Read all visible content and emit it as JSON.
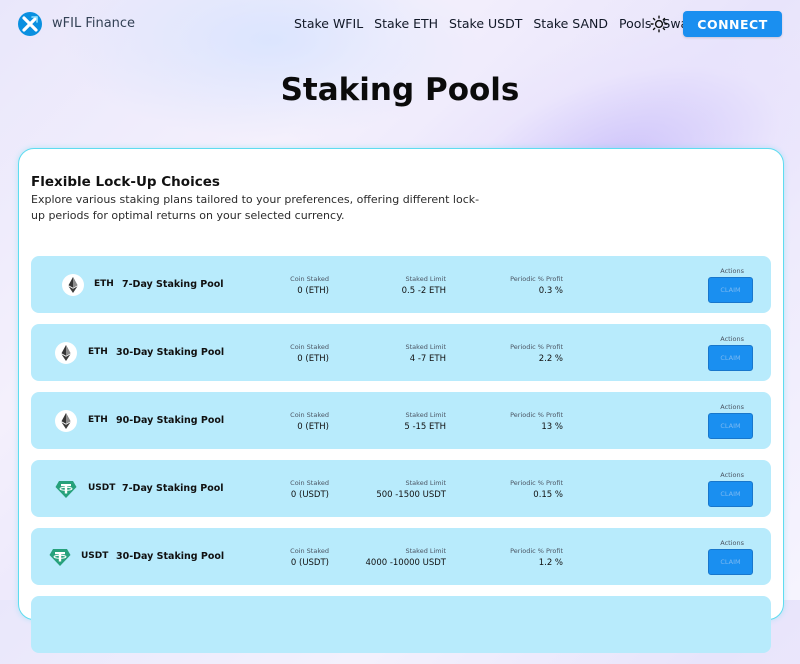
{
  "app": {
    "name": "wFIL Finance"
  },
  "nav": {
    "items": [
      "Stake WFIL",
      "Stake ETH",
      "Stake USDT",
      "Stake SAND",
      "Pools",
      "Swap"
    ],
    "connect_label": "CONNECT"
  },
  "page": {
    "title": "Staking Pools"
  },
  "card": {
    "heading": "Flexible Lock-Up Choices",
    "description": "Explore various staking plans tailored to your preferences, offering different lock-up periods for optimal returns on your selected currency."
  },
  "pools": {
    "headers": {
      "coin_staked": "Coin Staked",
      "staked_limit": "Staked Limit",
      "periodic_profit": "Periodic % Profit",
      "actions": "Actions"
    },
    "claim_label": "CLAIM",
    "rows": [
      {
        "coin": "ETH",
        "icon": "eth-icon",
        "name": "7-Day Staking Pool",
        "coin_staked": "0 (ETH)",
        "staked_limit": "0.5 -2 ETH",
        "profit": "0.3 %"
      },
      {
        "coin": "ETH",
        "icon": "eth-icon",
        "name": "30-Day Staking Pool",
        "coin_staked": "0 (ETH)",
        "staked_limit": "4 -7 ETH",
        "profit": "2.2 %"
      },
      {
        "coin": "ETH",
        "icon": "eth-icon",
        "name": "90-Day Staking Pool",
        "coin_staked": "0 (ETH)",
        "staked_limit": "5 -15 ETH",
        "profit": "13 %"
      },
      {
        "coin": "USDT",
        "icon": "usdt-icon",
        "name": "7-Day Staking Pool",
        "coin_staked": "0 (USDT)",
        "staked_limit": "500 -1500 USDT",
        "profit": "0.15 %"
      },
      {
        "coin": "USDT",
        "icon": "usdt-icon",
        "name": "30-Day Staking Pool",
        "coin_staked": "0 (USDT)",
        "staked_limit": "4000 -10000 USDT",
        "profit": "1.2 %"
      }
    ]
  },
  "colors": {
    "accent": "#1a8ff0",
    "row_bg": "#b8ebfc",
    "card_border": "#5fdcf0",
    "usdt": "#26a17b"
  }
}
